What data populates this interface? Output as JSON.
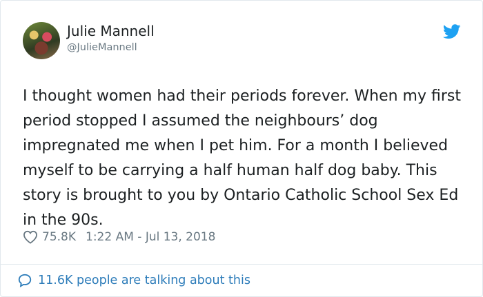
{
  "author": {
    "name": "Julie Mannell",
    "handle": "@JulieMannell"
  },
  "tweet": {
    "text": "I thought women had their periods forever. When my first period stopped I assumed the neighbours’ dog impregnated me when I pet him. For a month I believed myself to be carrying a half human half dog baby. This story is brought to you by Ontario Catholic School Sex Ed in the 90s.",
    "likes": "75.8K",
    "timestamp": "1:22 AM - Jul 13, 2018"
  },
  "footer": {
    "talking_label": "11.6K people are talking about this"
  },
  "icons": {
    "brand": "twitter-bird-icon",
    "like": "heart-icon",
    "conversation": "speech-bubble-icon"
  },
  "colors": {
    "twitter_blue": "#1da1f2",
    "link_blue": "#2b7bb9",
    "muted": "#697882",
    "text": "#1c2022"
  }
}
